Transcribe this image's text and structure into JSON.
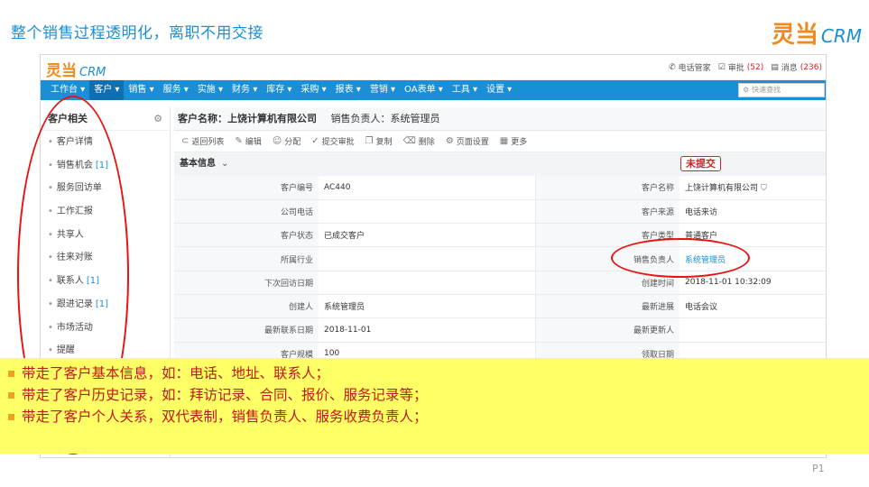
{
  "slide": {
    "title": "整个销售过程透明化，离职不用交接",
    "page_number": "P1"
  },
  "logo": {
    "mark": "灵当",
    "crm": "CRM"
  },
  "topbar": {
    "phone": "电话管家",
    "approval": "审批",
    "approval_count": "(52)",
    "messages": "消息",
    "message_count": "(236)"
  },
  "nav": {
    "items": [
      "工作台 ▾",
      "客户 ▾",
      "销售 ▾",
      "服务 ▾",
      "实施 ▾",
      "财务 ▾",
      "库存 ▾",
      "采购 ▾",
      "报表 ▾",
      "营销 ▾",
      "OA表单 ▾",
      "工具 ▾",
      "设置 ▾"
    ],
    "active_index": 1,
    "search_placeholder": "快速查找"
  },
  "sidebar": {
    "title": "客户相关",
    "items": [
      {
        "label": "客户详情",
        "count": ""
      },
      {
        "label": "销售机会",
        "count": "[1]"
      },
      {
        "label": "服务回访单",
        "count": ""
      },
      {
        "label": "工作汇报",
        "count": ""
      },
      {
        "label": "共享人",
        "count": ""
      },
      {
        "label": "往来对账",
        "count": ""
      },
      {
        "label": "联系人",
        "count": "[1]"
      },
      {
        "label": "跟进记录",
        "count": "[1]"
      },
      {
        "label": "市场活动",
        "count": ""
      },
      {
        "label": "提醒",
        "count": ""
      }
    ]
  },
  "header": {
    "name_label": "客户名称：上饶计算机有限公司",
    "owner_label": "销售负责人：系统管理员"
  },
  "toolbar": {
    "back": "返回列表",
    "edit": "编辑",
    "assign": "分配",
    "submit": "提交审批",
    "copy": "复制",
    "delete": "删除",
    "page_settings": "页面设置",
    "more": "更多"
  },
  "section": {
    "title": "基本信息",
    "stamp": "未提交"
  },
  "fields": [
    [
      "客户编号",
      "AC440",
      "客户名称",
      "上饶计算机有限公司"
    ],
    [
      "公司电话",
      "",
      "客户来源",
      "电话来访"
    ],
    [
      "客户状态",
      "已成交客户",
      "客户类型",
      "普通客户"
    ],
    [
      "所属行业",
      "",
      "销售负责人",
      "系统管理员"
    ],
    [
      "下次回访日期",
      "",
      "创建时间",
      "2018-11-01 10:32:09"
    ],
    [
      "创建人",
      "系统管理员",
      "最新进展",
      "电话会议"
    ],
    [
      "最新联系日期",
      "2018-11-01",
      "最新更新人",
      ""
    ],
    [
      "客户规模",
      "100",
      "领取日期",
      ""
    ]
  ],
  "notes": [
    "带走了客户基本信息，如：电话、地址、联系人；",
    "带走了客户历史记录，如：拜访记录、合同、报价、服务记录等；",
    "带走了客户个人关系，双代表制，销售负责人、服务收费负责人；"
  ],
  "colors": {
    "brand_blue": "#1a8fd6",
    "brand_orange": "#f08a1d",
    "annotation_red": "#e81414",
    "note_bg": "#ffff66"
  }
}
